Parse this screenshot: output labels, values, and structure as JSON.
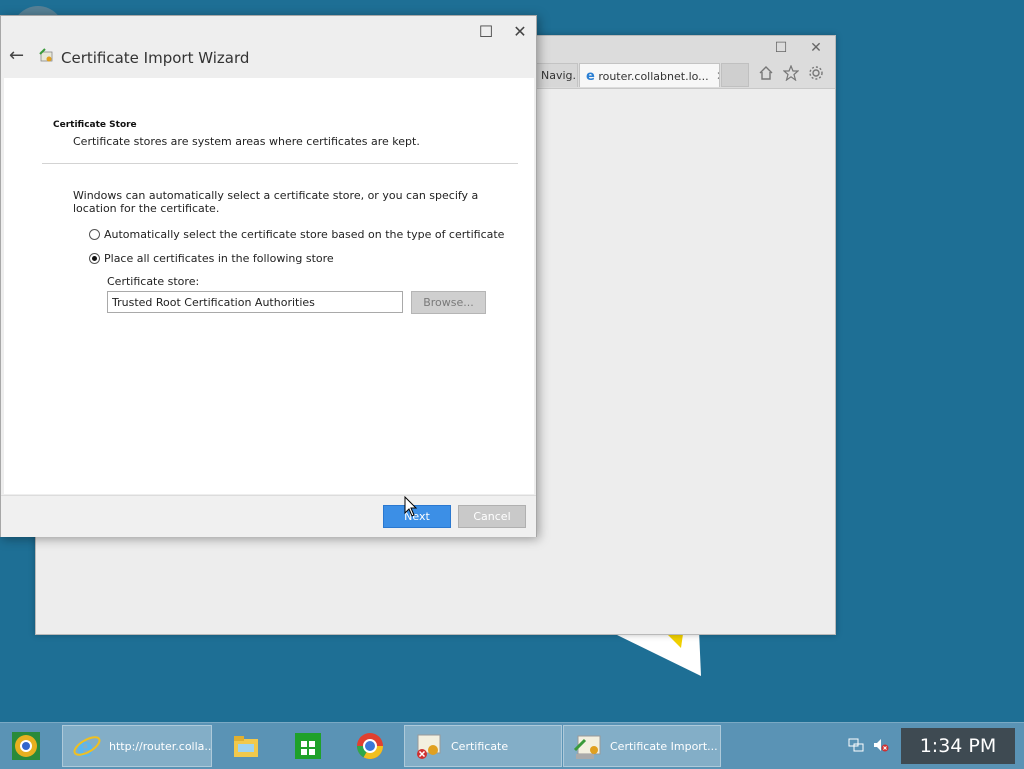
{
  "browser": {
    "tabs": [
      {
        "label": "Navig...",
        "active": false
      },
      {
        "label": "router.collabnet.lo...",
        "active": true
      }
    ],
    "tab_close": "✕",
    "window_controls": {
      "maximize": "☐",
      "close": "✕"
    },
    "toolbar_icons": [
      "home-icon",
      "star-icon",
      "gear-icon"
    ]
  },
  "wizard": {
    "title": "Certificate Import Wizard",
    "back_glyph": "←",
    "window_controls": {
      "maximize": "☐",
      "close": "✕"
    },
    "section_title": "Certificate Store",
    "section_desc": "Certificate stores are system areas where certificates are kept.",
    "intro": "Windows can automatically select a certificate store, or you can specify a location for the certificate.",
    "options": [
      {
        "label": "Automatically select the certificate store based on the type of certificate",
        "checked": false
      },
      {
        "label": "Place all certificates in the following store",
        "checked": true
      }
    ],
    "store_label": "Certificate store:",
    "store_value": "Trusted Root Certification Authorities",
    "browse_label": "Browse...",
    "next_label": "Next",
    "cancel_label": "Cancel"
  },
  "taskbar": {
    "items": [
      {
        "icon": "chrome-canary-icon",
        "label": ""
      },
      {
        "icon": "internet-explorer-icon",
        "label": "http://router.colla..."
      },
      {
        "icon": "file-explorer-icon",
        "label": ""
      },
      {
        "icon": "windows-store-icon",
        "label": ""
      },
      {
        "icon": "chrome-icon",
        "label": ""
      },
      {
        "icon": "certificate-icon",
        "label": "Certificate"
      },
      {
        "icon": "certificate-import-icon",
        "label": "Certificate Import..."
      }
    ],
    "clock": "1:34 PM"
  },
  "colors": {
    "desktop": "#1e6f95",
    "accent_button": "#3c8fe6",
    "taskbar": "#5a93b5"
  }
}
